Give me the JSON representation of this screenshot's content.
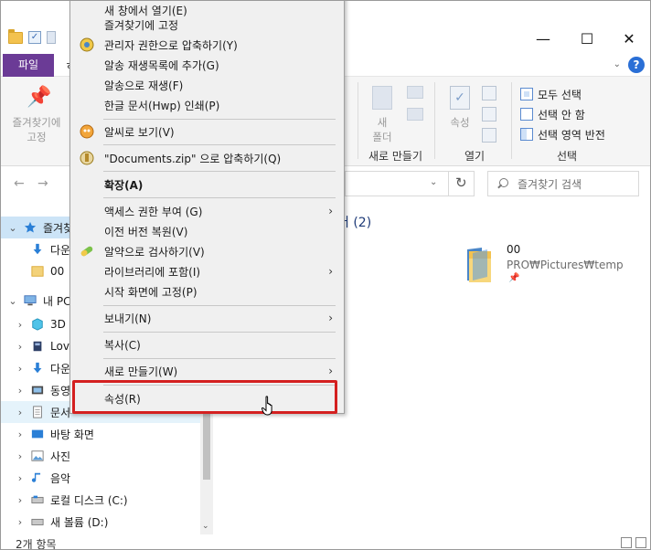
{
  "ribbon": {
    "tab_file": "파일",
    "tab_cut": "ㅎ",
    "pin_label_line1": "즐겨찾기에",
    "pin_label_line2": "고정",
    "new_folder_line1": "새",
    "new_folder_line2": "폴더",
    "properties_label": "속성",
    "group_new": "새로 만들기",
    "group_open": "열기",
    "group_select": "선택",
    "select_all": "모두 선택",
    "select_none": "선택 안 함",
    "invert_select": "선택 영역 반전"
  },
  "titlebar": {
    "minimize": "—",
    "maximize": "☐",
    "close": "✕"
  },
  "address": {
    "refresh": "↻",
    "dropdown": "⌄",
    "search_placeholder": "즐겨찾기 검색"
  },
  "nav": {
    "quick_access": "즐겨찾",
    "downloads": "다운",
    "folder_00": "00",
    "this_pc": "내 PC",
    "objects3d": "3D",
    "love": "Lov",
    "downloads2": "다운",
    "videos": "동영",
    "documents": "문서",
    "desktop": "바탕 화면",
    "pictures": "사진",
    "music": "음악",
    "local_disk": "로컬 디스크 (C:)",
    "new_volume": "새 볼륨 (D:)"
  },
  "content": {
    "header": "더 (2)",
    "item_name": "00",
    "item_path": "PRO₩Pictures₩temp"
  },
  "status": {
    "count": "2개 항목"
  },
  "context_menu": {
    "open_new_window": "새 창에서 열기(E)",
    "pin_quick": "즐겨찾기에 고정",
    "compress_admin": "관리자 권한으로 압축하기(Y)",
    "add_playlist": "알송 재생목록에 추가(G)",
    "play_alsong": "알송으로 재생(F)",
    "print_hwp": "한글 문서(Hwp) 인쇄(P)",
    "view_alsee": "알씨로 보기(V)",
    "compress_zip": "\"Documents.zip\" 으로 압축하기(Q)",
    "expand": "확장(A)",
    "grant_access": "액세스 권한 부여 (G)",
    "restore_versions": "이전 버전 복원(V)",
    "scan_alyac": "알약으로 검사하기(V)",
    "include_library": "라이브러리에 포함(I)",
    "pin_start": "시작 화면에 고정(P)",
    "send_to": "보내기(N)",
    "copy": "복사(C)",
    "new": "새로 만들기(W)",
    "properties": "속성(R)"
  },
  "colors": {
    "file_tab": "#6b3b96",
    "selected_nav": "#cce4f7",
    "highlight_box": "#d42020",
    "accent": "#2a6fd6"
  }
}
